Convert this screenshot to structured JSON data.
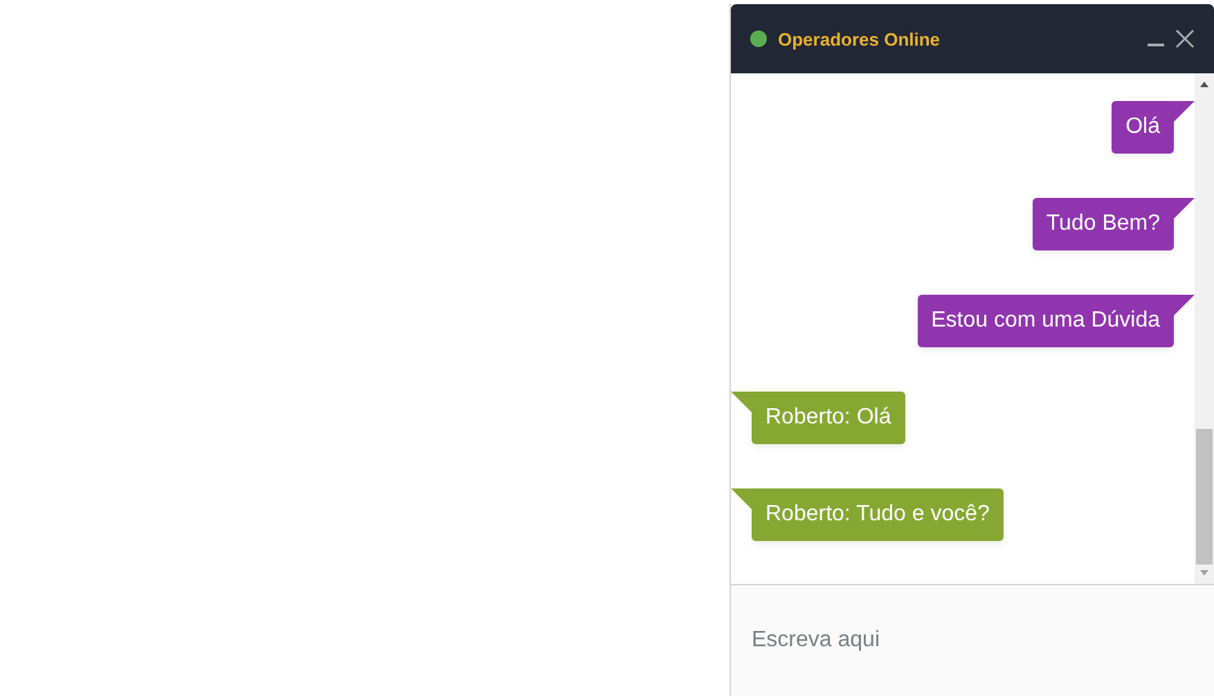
{
  "chat": {
    "title": "Operadores Online",
    "messages": [
      {
        "kind": "sent",
        "text": "Olá"
      },
      {
        "kind": "sent",
        "text": "Tudo Bem?"
      },
      {
        "kind": "sent",
        "text": "Estou com uma Dúvida"
      },
      {
        "kind": "received",
        "text": "Roberto: Olá"
      },
      {
        "kind": "received",
        "text": "Roberto: Tudo e você?"
      }
    ],
    "input": {
      "placeholder": "Escreva aqui"
    }
  }
}
